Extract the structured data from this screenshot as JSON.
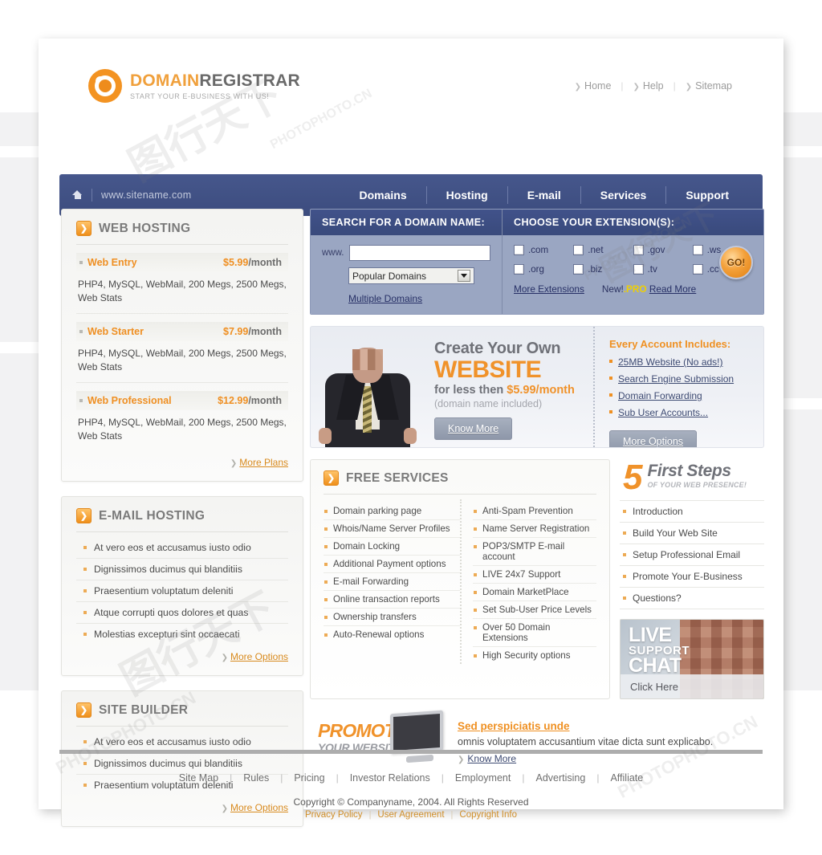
{
  "brand": {
    "name_part1": "DOMAIN",
    "name_part2": "REGISTRAR",
    "tagline": "START YOUR E-BUSINESS WITH US!",
    "accent_orange": "#ef9022",
    "nav_blue": "#3f508a"
  },
  "top_links": [
    {
      "label": "Home"
    },
    {
      "label": "Help"
    },
    {
      "label": "Sitemap"
    }
  ],
  "nav": {
    "site_url": "www.sitename.com",
    "items": [
      {
        "label": "Domains"
      },
      {
        "label": "Hosting"
      },
      {
        "label": "E-mail"
      },
      {
        "label": "Services"
      },
      {
        "label": "Support"
      }
    ]
  },
  "web_hosting": {
    "title": "WEB HOSTING",
    "plans": [
      {
        "name": "Web Entry",
        "price": "$5.99",
        "per": "/month",
        "desc": "PHP4, MySQL, WebMail, 200 Megs, 2500 Megs, Web Stats"
      },
      {
        "name": "Web Starter",
        "price": "$7.99",
        "per": "/month",
        "desc": "PHP4, MySQL, WebMail, 200 Megs, 2500 Megs, Web Stats"
      },
      {
        "name": "Web Professional",
        "price": "$12.99",
        "per": "/month",
        "desc": "PHP4, MySQL, WebMail, 200 Megs, 2500 Megs, Web Stats"
      }
    ],
    "more_label": "More Plans"
  },
  "email_hosting": {
    "title": "E-MAIL HOSTING",
    "items": [
      "At vero eos et accusamus iusto odio",
      "Dignissimos ducimus qui blanditiis",
      "Praesentium voluptatum deleniti",
      "Atque corrupti quos dolores et quas",
      "Molestias excepturi sint occaecati"
    ],
    "more_label": "More Options"
  },
  "site_builder": {
    "title": "SITE BUILDER",
    "items": [
      "At vero eos et accusamus iusto odio",
      "Dignissimos ducimus qui blanditiis",
      "Praesentium voluptatum deleniti"
    ],
    "more_label": "More Options"
  },
  "search": {
    "heading": "SEARCH FOR A DOMAIN NAME:",
    "www_label": "www.",
    "input_value": "",
    "input_placeholder": "",
    "select_value": "Popular Domains",
    "select_options": [
      "Popular Domains"
    ],
    "multiple_domains_label": "Multiple Domains"
  },
  "extensions": {
    "heading": "CHOOSE YOUR EXTENSION(S):",
    "items": [
      {
        "label": ".com",
        "checked": false
      },
      {
        "label": ".net",
        "checked": false
      },
      {
        "label": ".gov",
        "checked": false
      },
      {
        "label": ".ws",
        "checked": false
      },
      {
        "label": ".org",
        "checked": false
      },
      {
        "label": ".biz",
        "checked": false
      },
      {
        "label": ".tv",
        "checked": false
      },
      {
        "label": ".cc",
        "checked": false
      }
    ],
    "more_extensions_label": "More Extensions",
    "new_prefix": "New!",
    "new_tld": ".PRO",
    "read_more_label": "Read More",
    "go_label": "GO!"
  },
  "hero": {
    "line1": "Create Your Own",
    "line2": "WEBSITE",
    "line3_pre": "for less then ",
    "line3_price": "$5.99/month",
    "line4": "(domain name included)",
    "button": "Know More",
    "includes_title": "Every Account Includes:",
    "includes": [
      "25MB Website (No ads!)",
      "Search Engine Submission",
      "Domain Forwarding",
      "Sub User Accounts..."
    ],
    "includes_button": "More Options"
  },
  "free_services": {
    "title": "FREE SERVICES",
    "col_left": [
      "Domain parking page",
      "Whois/Name Server Profiles",
      "Domain Locking",
      "Additional Payment options",
      "E-mail Forwarding",
      "Online transaction reports",
      "Ownership transfers",
      "Auto-Renewal options"
    ],
    "col_right": [
      "Anti-Spam Prevention",
      "Name Server Registration",
      "POP3/SMTP E-mail account",
      "LIVE 24x7 Support",
      "Domain MarketPlace",
      "Set Sub-User Price Levels",
      "Over 50 Domain Extensions",
      "High Security options"
    ]
  },
  "first_steps": {
    "number": "5",
    "title": "First Steps",
    "subtitle": "OF YOUR WEB PRESENCE!",
    "items": [
      "Introduction",
      "Build Your Web Site",
      "Setup Professional Email",
      "Promote Your E-Business",
      "Questions?"
    ]
  },
  "live_chat": {
    "line1": "LIVE",
    "line2": "SUPPORT",
    "line3": "CHAT",
    "cta": "Click Here"
  },
  "promote": {
    "art_line1": "PROMOTE",
    "art_line2": "YOUR WEBSITE!",
    "headline": "Sed perspiciatis unde",
    "body": "omnis voluptatem accusantium vitae dicta sunt explicabo.",
    "link": "Know More"
  },
  "footer": {
    "links": [
      "Site Map",
      "Rules",
      "Pricing",
      "Investor Relations",
      "Employment",
      "Advertising",
      "Affiliate"
    ],
    "copyright": "Copyright © Companyname, 2004. All Rights Reserved",
    "legal": [
      "Privacy Policy",
      "User Agreement",
      "Copyright Info"
    ]
  },
  "watermarks": {
    "w1": "图行天下",
    "w2": "PHOTOPHOTO.CN",
    "w3": "PHOTOPHOTO.CN"
  }
}
